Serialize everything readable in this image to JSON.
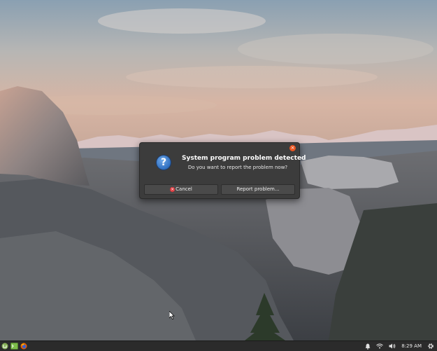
{
  "dialog": {
    "title": "System program problem detected",
    "message": "Do you want to report the problem now?",
    "cancel_label": "Cancel",
    "report_label": "Report problem...",
    "info_icon_glyph": "?",
    "cancel_icon_glyph": "×",
    "close_icon_glyph": "×"
  },
  "taskbar": {
    "clock": "8:29 AM"
  },
  "icons": {
    "menu": "mint-menu-icon",
    "terminal": "terminal-icon",
    "browser": "firefox-icon",
    "notifications": "bell-icon",
    "network": "wifi-icon",
    "volume": "speaker-icon",
    "settings": "gear-icon"
  },
  "colors": {
    "dialog_bg": "#3c3c3c",
    "close_accent": "#e95420",
    "cancel_red": "#e0393e",
    "info_blue": "#2f6fc0",
    "panel_bg": "#2b2b2b"
  }
}
